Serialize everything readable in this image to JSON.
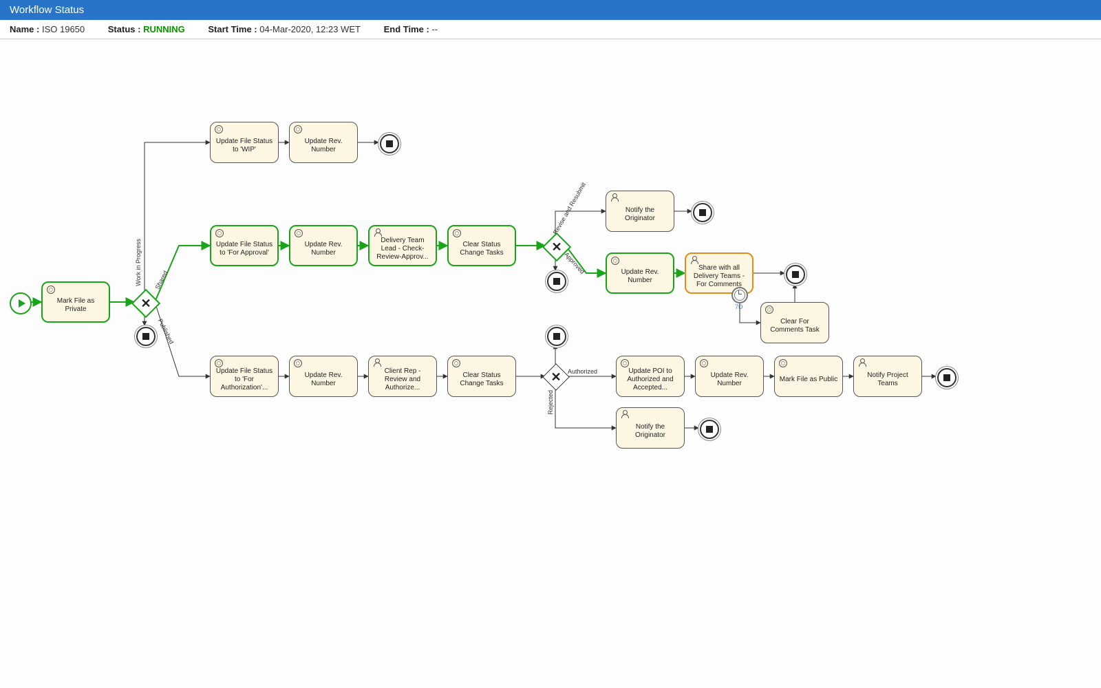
{
  "header": {
    "title": "Workflow Status"
  },
  "meta": {
    "name_label": "Name :",
    "name_value": "ISO 19650",
    "status_label": "Status :",
    "status_value": "RUNNING",
    "start_label": "Start Time :",
    "start_value": "04-Mar-2020, 12:23 WET",
    "end_label": "End Time :",
    "end_value": "--"
  },
  "tasks": {
    "mark_private": "Mark File as Private",
    "upd_wip": "Update File Status to 'WIP'",
    "upd_rev_top": "Update Rev. Number",
    "upd_for_approval": "Update File Status to 'For Approval'",
    "upd_rev_mid": "Update Rev. Number",
    "delivery_lead": "Delivery Team Lead - Check-Review-Approv...",
    "clear_status_mid": "Clear Status Change Tasks",
    "notify_orig_top": "Notify the Originator",
    "upd_rev_share": "Update Rev. Number",
    "share_all": "Share with all Delivery Teams - For Comments",
    "clear_comments": "Clear For Comments Task",
    "upd_for_auth": "Update File Status to 'For Authorization'...",
    "upd_rev_pub": "Update Rev. Number",
    "client_rep": "Client Rep - Review and Authorize...",
    "clear_status_pub": "Clear Status Change Tasks",
    "upd_poi": "Update POI to Authorized and Accepted...",
    "upd_rev_pub2": "Update Rev. Number",
    "mark_public": "Mark File as Public",
    "notify_teams": "Notify Project Teams",
    "notify_orig_bot": "Notify the Originator"
  },
  "gateway_labels": {
    "g1_wip": "Work in Progress",
    "g1_shared": "Shared",
    "g1_published": "Published",
    "g2_revise": "Revise and Resubmit",
    "g2_approved": "Approved",
    "g3_authorized": "Authorized",
    "g3_rejected": "Rejected",
    "timer": "7D"
  },
  "chart_data": {
    "type": "bpmn-workflow",
    "start": "start",
    "nodes": [
      {
        "id": "start",
        "type": "start-event"
      },
      {
        "id": "mark_private",
        "type": "service-task",
        "label": "Mark File as Private",
        "state": "active"
      },
      {
        "id": "g1",
        "type": "exclusive-gateway",
        "state": "active"
      },
      {
        "id": "end_g1",
        "type": "end-event"
      },
      {
        "id": "upd_wip",
        "type": "service-task",
        "label": "Update File Status to 'WIP'"
      },
      {
        "id": "upd_rev_top",
        "type": "service-task",
        "label": "Update Rev. Number"
      },
      {
        "id": "end_top",
        "type": "end-event"
      },
      {
        "id": "upd_for_approval",
        "type": "service-task",
        "label": "Update File Status to 'For Approval'",
        "state": "active"
      },
      {
        "id": "upd_rev_mid",
        "type": "service-task",
        "label": "Update Rev. Number",
        "state": "active"
      },
      {
        "id": "delivery_lead",
        "type": "user-task",
        "label": "Delivery Team Lead - Check-Review-Approv...",
        "state": "active"
      },
      {
        "id": "clear_status_mid",
        "type": "service-task",
        "label": "Clear Status Change Tasks",
        "state": "active"
      },
      {
        "id": "g2",
        "type": "exclusive-gateway",
        "state": "active"
      },
      {
        "id": "end_g2",
        "type": "end-event"
      },
      {
        "id": "notify_orig_top",
        "type": "user-task",
        "label": "Notify the Originator"
      },
      {
        "id": "end_notify_top",
        "type": "end-event"
      },
      {
        "id": "upd_rev_share",
        "type": "service-task",
        "label": "Update Rev. Number",
        "state": "active"
      },
      {
        "id": "share_all",
        "type": "user-task",
        "label": "Share with all Delivery Teams - For Comments",
        "state": "current"
      },
      {
        "id": "timer",
        "type": "timer-event",
        "label": "7D"
      },
      {
        "id": "end_share",
        "type": "end-event"
      },
      {
        "id": "clear_comments",
        "type": "service-task",
        "label": "Clear For Comments Task"
      },
      {
        "id": "upd_for_auth",
        "type": "service-task",
        "label": "Update File Status to 'For Authorization'..."
      },
      {
        "id": "upd_rev_pub",
        "type": "service-task",
        "label": "Update Rev. Number"
      },
      {
        "id": "client_rep",
        "type": "user-task",
        "label": "Client Rep - Review and Authorize..."
      },
      {
        "id": "clear_status_pub",
        "type": "service-task",
        "label": "Clear Status Change Tasks"
      },
      {
        "id": "g3",
        "type": "exclusive-gateway"
      },
      {
        "id": "end_g3",
        "type": "end-event"
      },
      {
        "id": "upd_poi",
        "type": "service-task",
        "label": "Update POI to Authorized and Accepted..."
      },
      {
        "id": "upd_rev_pub2",
        "type": "service-task",
        "label": "Update Rev. Number"
      },
      {
        "id": "mark_public",
        "type": "service-task",
        "label": "Mark File as Public"
      },
      {
        "id": "notify_teams",
        "type": "user-task",
        "label": "Notify Project Teams"
      },
      {
        "id": "end_pub",
        "type": "end-event"
      },
      {
        "id": "notify_orig_bot",
        "type": "user-task",
        "label": "Notify the Originator"
      },
      {
        "id": "end_notify_bot",
        "type": "end-event"
      }
    ],
    "flows": [
      {
        "from": "start",
        "to": "mark_private",
        "state": "active"
      },
      {
        "from": "mark_private",
        "to": "g1",
        "state": "active"
      },
      {
        "from": "g1",
        "to": "end_g1"
      },
      {
        "from": "g1",
        "to": "upd_wip",
        "label": "Work in Progress"
      },
      {
        "from": "g1",
        "to": "upd_for_approval",
        "label": "Shared",
        "state": "active"
      },
      {
        "from": "g1",
        "to": "upd_for_auth",
        "label": "Published"
      },
      {
        "from": "upd_wip",
        "to": "upd_rev_top"
      },
      {
        "from": "upd_rev_top",
        "to": "end_top"
      },
      {
        "from": "upd_for_approval",
        "to": "upd_rev_mid",
        "state": "active"
      },
      {
        "from": "upd_rev_mid",
        "to": "delivery_lead",
        "state": "active"
      },
      {
        "from": "delivery_lead",
        "to": "clear_status_mid",
        "state": "active"
      },
      {
        "from": "clear_status_mid",
        "to": "g2",
        "state": "active"
      },
      {
        "from": "g2",
        "to": "end_g2"
      },
      {
        "from": "g2",
        "to": "notify_orig_top",
        "label": "Revise and Resubmit"
      },
      {
        "from": "notify_orig_top",
        "to": "end_notify_top"
      },
      {
        "from": "g2",
        "to": "upd_rev_share",
        "label": "Approved",
        "state": "active"
      },
      {
        "from": "upd_rev_share",
        "to": "share_all",
        "state": "active"
      },
      {
        "from": "share_all",
        "to": "end_share"
      },
      {
        "from": "timer",
        "to": "clear_comments"
      },
      {
        "from": "clear_comments",
        "to": "end_share"
      },
      {
        "from": "upd_for_auth",
        "to": "upd_rev_pub"
      },
      {
        "from": "upd_rev_pub",
        "to": "client_rep"
      },
      {
        "from": "client_rep",
        "to": "clear_status_pub"
      },
      {
        "from": "clear_status_pub",
        "to": "g3"
      },
      {
        "from": "g3",
        "to": "end_g3"
      },
      {
        "from": "g3",
        "to": "upd_poi",
        "label": "Authorized"
      },
      {
        "from": "g3",
        "to": "notify_orig_bot",
        "label": "Rejected"
      },
      {
        "from": "upd_poi",
        "to": "upd_rev_pub2"
      },
      {
        "from": "upd_rev_pub2",
        "to": "mark_public"
      },
      {
        "from": "mark_public",
        "to": "notify_teams"
      },
      {
        "from": "notify_teams",
        "to": "end_pub"
      },
      {
        "from": "notify_orig_bot",
        "to": "end_notify_bot"
      }
    ]
  }
}
